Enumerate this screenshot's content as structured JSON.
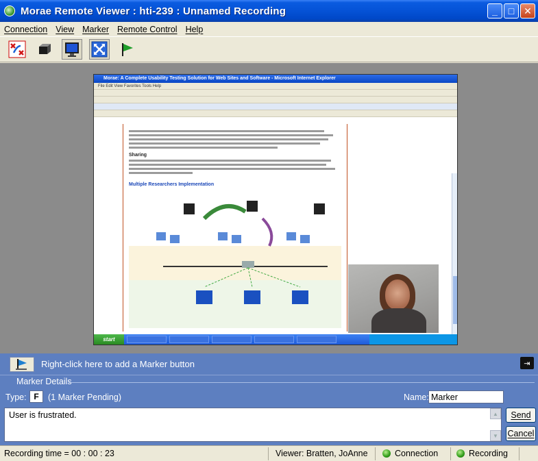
{
  "window": {
    "title": "Morae Remote Viewer : hti-239 : Unnamed Recording",
    "min_glyph": "_",
    "max_glyph": "□",
    "close_glyph": "✕"
  },
  "menu": [
    "Connection",
    "View",
    "Marker",
    "Remote Control",
    "Help"
  ],
  "toolbar": {
    "icons": [
      "disconnect-icon",
      "blank-screen-icon",
      "display-icon",
      "fit-to-window-icon",
      "marker-flag-icon"
    ]
  },
  "remote_screen": {
    "browser_title": "Morae: A Complete Usability Testing Solution for Web Sites and Software - Microsoft Internet Explorer",
    "menu_row": "File  Edit  View  Favorites  Tools  Help",
    "doc_heading_sharing": "Sharing",
    "doc_heading_multi": "Multiple Researchers Implementation",
    "start_label": "start"
  },
  "marker_strip": {
    "hint": "Right-click here to add a Marker button",
    "dock_glyph": "⇥"
  },
  "marker_details": {
    "title": "Marker Details",
    "type_label": "Type:",
    "type_value": "F",
    "pending": "(1 Marker Pending)",
    "name_label": "Name:",
    "name_value": "Marker",
    "notes_value": "User is frustrated.",
    "send_label": "Send",
    "cancel_label": "Cancel",
    "scroll_up": "▲",
    "scroll_down": "▼"
  },
  "status": {
    "recording_time": "Recording time = 00 : 00 : 23",
    "viewer": "Viewer: Bratten, JoAnne",
    "connection": "Connection",
    "recording": "Recording"
  },
  "colors": {
    "title_bar": "#0552d6",
    "panel_blue": "#5d7fc0",
    "status_green": "#2f9a18"
  }
}
